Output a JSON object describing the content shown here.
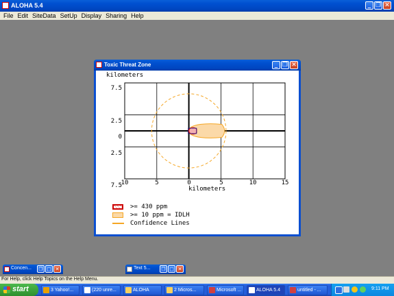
{
  "app": {
    "title": "ALOHA 5.4",
    "menu": [
      "File",
      "Edit",
      "SiteData",
      "SetUp",
      "Display",
      "Sharing",
      "Help"
    ]
  },
  "threat_window": {
    "title": "Toxic Threat Zone",
    "y_unit": "kilometers",
    "x_unit": "kilometers",
    "y_ticks": [
      "7.5",
      "2.5",
      "0",
      "2.5",
      "7.5"
    ],
    "x_ticks": [
      "10",
      "5",
      "0",
      "5",
      "10",
      "15"
    ],
    "legend": [
      {
        "label": ">= 430 ppm",
        "color": "#cc0000"
      },
      {
        "label": ">= 10 ppm = IDLH",
        "color": "#f5a623"
      },
      {
        "label": "Confidence Lines",
        "color": "#f5a623"
      }
    ]
  },
  "chart_data": {
    "type": "threat_zone",
    "xlabel": "kilometers",
    "ylabel": "kilometers",
    "xlim": [
      -10,
      15
    ],
    "ylim": [
      -7.5,
      7.5
    ],
    "x_ticks": [
      -10,
      -5,
      0,
      5,
      10,
      15
    ],
    "y_ticks": [
      7.5,
      2.5,
      0,
      -2.5,
      -7.5
    ],
    "grid": true,
    "zones": [
      {
        "name": ">= 430 ppm",
        "color": "#cc0000",
        "x_end": 1.2,
        "half_width": 0.6
      },
      {
        "name": ">= 10 ppm = IDLH",
        "color": "#f5a623",
        "x_end": 6.0,
        "half_width": 1.2
      }
    ],
    "confidence_circle_radius": 5.8,
    "legend_position": "bottom-left"
  },
  "minimized": [
    {
      "title": "Concen..."
    },
    {
      "title": "Text 5..."
    }
  ],
  "status_bar": "For Help, click Help Topics on the Help Menu.",
  "taskbar": {
    "start": "start",
    "items": [
      {
        "label": "3 Yahoo!...",
        "color": "#e8a000"
      },
      {
        "label": "(220 unre...",
        "color": "#ffffff"
      },
      {
        "label": "ALOHA",
        "color": "#f5d060"
      },
      {
        "label": "2 Micros...",
        "color": "#f5d060"
      },
      {
        "label": "Microsoft ...",
        "color": "#d04040"
      },
      {
        "label": "ALOHA 5.4",
        "color": "#ffffff"
      },
      {
        "label": "untitled - ...",
        "color": "#d04040"
      }
    ],
    "clock": "9:11 PM"
  }
}
